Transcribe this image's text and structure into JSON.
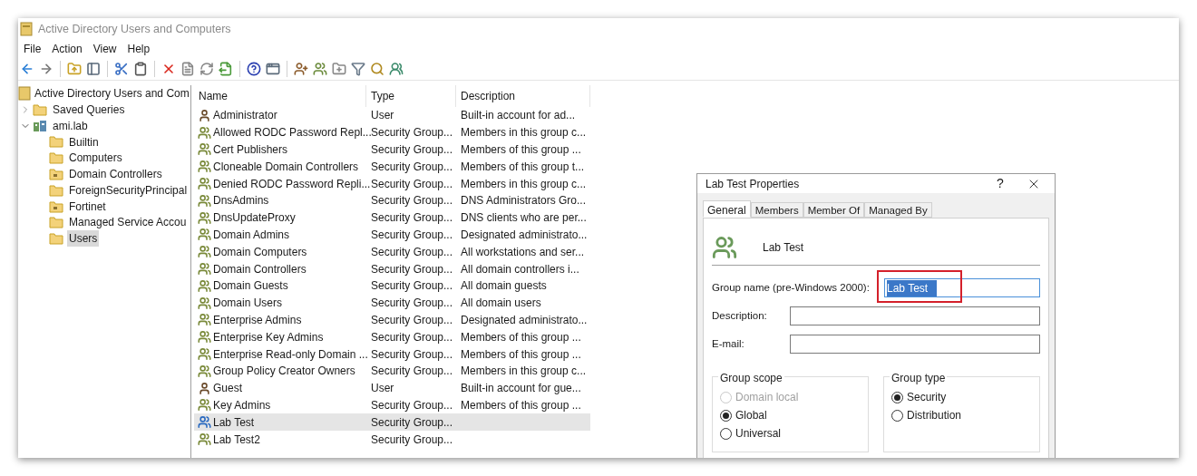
{
  "window": {
    "title": "Active Directory Users and Computers"
  },
  "menu": [
    "File",
    "Action",
    "View",
    "Help"
  ],
  "tree": {
    "label": "Active Directory Users and Com",
    "children": [
      {
        "label": "Saved Queries",
        "kind": "folder",
        "expanded": false,
        "selected": false
      },
      {
        "label": "ami.lab",
        "kind": "domain",
        "expanded": true,
        "selected": false,
        "children": [
          {
            "label": "Builtin",
            "kind": "folder",
            "selected": false
          },
          {
            "label": "Computers",
            "kind": "folder",
            "selected": false
          },
          {
            "label": "Domain Controllers",
            "kind": "ou",
            "selected": false
          },
          {
            "label": "ForeignSecurityPrincipal",
            "kind": "folder",
            "selected": false
          },
          {
            "label": "Fortinet",
            "kind": "ou",
            "selected": false
          },
          {
            "label": "Managed Service Accou",
            "kind": "folder",
            "selected": false
          },
          {
            "label": "Users",
            "kind": "folder",
            "selected": true
          }
        ]
      }
    ]
  },
  "table": {
    "columns": [
      "Name",
      "Type",
      "Description"
    ],
    "rows": [
      {
        "name": "Administrator",
        "kind": "user",
        "type": "User",
        "description": "Built-in account for ad...",
        "selected": false
      },
      {
        "name": "Allowed RODC Password Repl...",
        "kind": "group",
        "type": "Security Group...",
        "description": "Members in this group c...",
        "selected": false
      },
      {
        "name": "Cert Publishers",
        "kind": "group",
        "type": "Security Group...",
        "description": "Members of this group ...",
        "selected": false
      },
      {
        "name": "Cloneable Domain Controllers",
        "kind": "group",
        "type": "Security Group...",
        "description": "Members of this group t...",
        "selected": false
      },
      {
        "name": "Denied RODC Password Repli...",
        "kind": "group",
        "type": "Security Group...",
        "description": "Members in this group c...",
        "selected": false
      },
      {
        "name": "DnsAdmins",
        "kind": "group",
        "type": "Security Group...",
        "description": "DNS Administrators Gro...",
        "selected": false
      },
      {
        "name": "DnsUpdateProxy",
        "kind": "group",
        "type": "Security Group...",
        "description": "DNS clients who are per...",
        "selected": false
      },
      {
        "name": "Domain Admins",
        "kind": "group",
        "type": "Security Group...",
        "description": "Designated administrato...",
        "selected": false
      },
      {
        "name": "Domain Computers",
        "kind": "group",
        "type": "Security Group...",
        "description": "All workstations and ser...",
        "selected": false
      },
      {
        "name": "Domain Controllers",
        "kind": "group",
        "type": "Security Group...",
        "description": "All domain controllers i...",
        "selected": false
      },
      {
        "name": "Domain Guests",
        "kind": "group",
        "type": "Security Group...",
        "description": "All domain guests",
        "selected": false
      },
      {
        "name": "Domain Users",
        "kind": "group",
        "type": "Security Group...",
        "description": "All domain users",
        "selected": false
      },
      {
        "name": "Enterprise Admins",
        "kind": "group",
        "type": "Security Group...",
        "description": "Designated administrato...",
        "selected": false
      },
      {
        "name": "Enterprise Key Admins",
        "kind": "group",
        "type": "Security Group...",
        "description": "Members of this group ...",
        "selected": false
      },
      {
        "name": "Enterprise Read-only Domain ...",
        "kind": "group",
        "type": "Security Group...",
        "description": "Members of this group ...",
        "selected": false
      },
      {
        "name": "Group Policy Creator Owners",
        "kind": "group",
        "type": "Security Group...",
        "description": "Members in this group c...",
        "selected": false
      },
      {
        "name": "Guest",
        "kind": "user",
        "type": "User",
        "description": "Built-in account for gue...",
        "selected": false
      },
      {
        "name": "Key Admins",
        "kind": "group",
        "type": "Security Group...",
        "description": "Members of this group ...",
        "selected": false
      },
      {
        "name": "Lab Test",
        "kind": "group",
        "type": "Security Group...",
        "selected": true
      },
      {
        "name": "Lab Test2",
        "kind": "group",
        "type": "Security Group...",
        "selected": false
      }
    ]
  },
  "dialog": {
    "title": "Lab Test Properties",
    "help": "?",
    "tabs": [
      {
        "label": "General",
        "selected": true
      },
      {
        "label": "Members",
        "selected": false
      },
      {
        "label": "Member Of",
        "selected": false
      },
      {
        "label": "Managed By",
        "selected": false
      }
    ],
    "object_name": "Lab Test",
    "fields": [
      {
        "label": "Group name (pre-Windows 2000):",
        "value": "Lab Test",
        "text_selected": true,
        "annotated": true
      },
      {
        "label": "Description:",
        "text_selected": false,
        "annotated": false
      },
      {
        "label": "E-mail:",
        "text_selected": false,
        "annotated": false
      }
    ],
    "group_scope": {
      "title": "Group scope",
      "options": [
        {
          "label": "Domain local",
          "selected": false,
          "disabled": true
        },
        {
          "label": "Global",
          "selected": true,
          "disabled": false
        },
        {
          "label": "Universal",
          "selected": false,
          "disabled": false
        }
      ]
    },
    "group_type": {
      "title": "Group type",
      "options": [
        {
          "label": "Security",
          "selected": true,
          "disabled": false
        },
        {
          "label": "Distribution",
          "selected": false,
          "disabled": false
        }
      ]
    }
  }
}
